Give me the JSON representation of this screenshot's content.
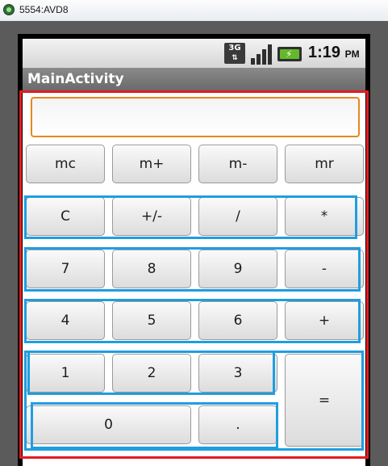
{
  "window": {
    "title": "5554:AVD8",
    "icon": "android-emulator-icon"
  },
  "status_bar": {
    "network": "3G",
    "time": "1:19",
    "ampm": "PM"
  },
  "activity": {
    "title": "MainActivity"
  },
  "display": {
    "value": ""
  },
  "keys": {
    "mc": "mc",
    "mplus": "m+",
    "mminus": "m-",
    "mr": "mr",
    "clear": "C",
    "sign": "+/-",
    "divide": "/",
    "multiply": "*",
    "seven": "7",
    "eight": "8",
    "nine": "9",
    "minus": "-",
    "four": "4",
    "five": "5",
    "six": "6",
    "plus": "+",
    "one": "1",
    "two": "2",
    "three": "3",
    "equals": "=",
    "zero": "0",
    "dot": "."
  },
  "colors": {
    "outer_highlight": "#e41b23",
    "row_highlight": "#1e9ee0",
    "display_border": "#e8881c",
    "battery": "#63b92b"
  }
}
